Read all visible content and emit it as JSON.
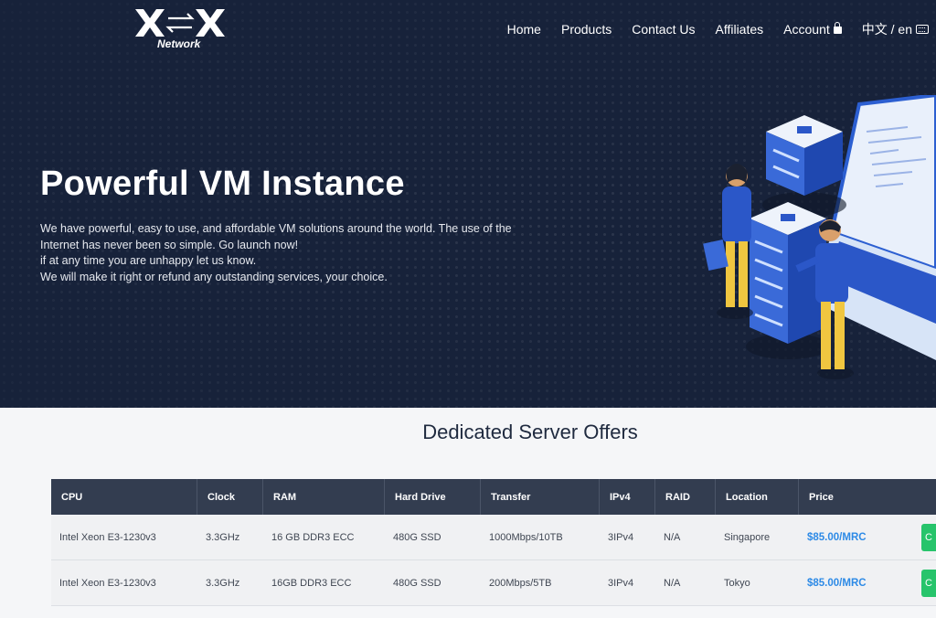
{
  "brand": {
    "mark": "X X",
    "sub": "Network"
  },
  "nav": [
    {
      "label": "Home"
    },
    {
      "label": "Products"
    },
    {
      "label": "Contact Us"
    },
    {
      "label": "Affiliates"
    },
    {
      "label": "Account"
    },
    {
      "label": "中文 / en"
    }
  ],
  "hero": {
    "title": "Powerful VM Instance",
    "lines": [
      "We have powerful, easy to use, and affordable VM solutions around the world. The use of the",
      "Internet has never been so simple. Go launch now!",
      "if at any time you are unhappy let us know.",
      "We will make it right or refund any outstanding services, your choice."
    ]
  },
  "offers": {
    "title": "Dedicated Server Offers",
    "columns": [
      "CPU",
      "Clock",
      "RAM",
      "Hard Drive",
      "Transfer",
      "IPv4",
      "RAID",
      "Location",
      "Price"
    ],
    "rows": [
      {
        "cpu": "Intel Xeon E3-1230v3",
        "clock": "3.3GHz",
        "ram": "16 GB DDR3 ECC",
        "disk": "480G SSD",
        "transfer": "1000Mbps/10TB",
        "ipv4": "3IPv4",
        "raid": "N/A",
        "location": "Singapore",
        "price": "$85.00/MRC",
        "btn": "C"
      },
      {
        "cpu": "Intel Xeon E3-1230v3",
        "clock": "3.3GHz",
        "ram": "16GB DDR3 ECC",
        "disk": "480G SSD",
        "transfer": "200Mbps/5TB",
        "ipv4": "3IPv4",
        "raid": "N/A",
        "location": "Tokyo",
        "price": "$85.00/MRC",
        "btn": "C"
      }
    ]
  },
  "colors": {
    "hero_bg": "#17223a",
    "table_head": "#333d50",
    "price": "#2d8ae6",
    "button": "#27c46b"
  }
}
